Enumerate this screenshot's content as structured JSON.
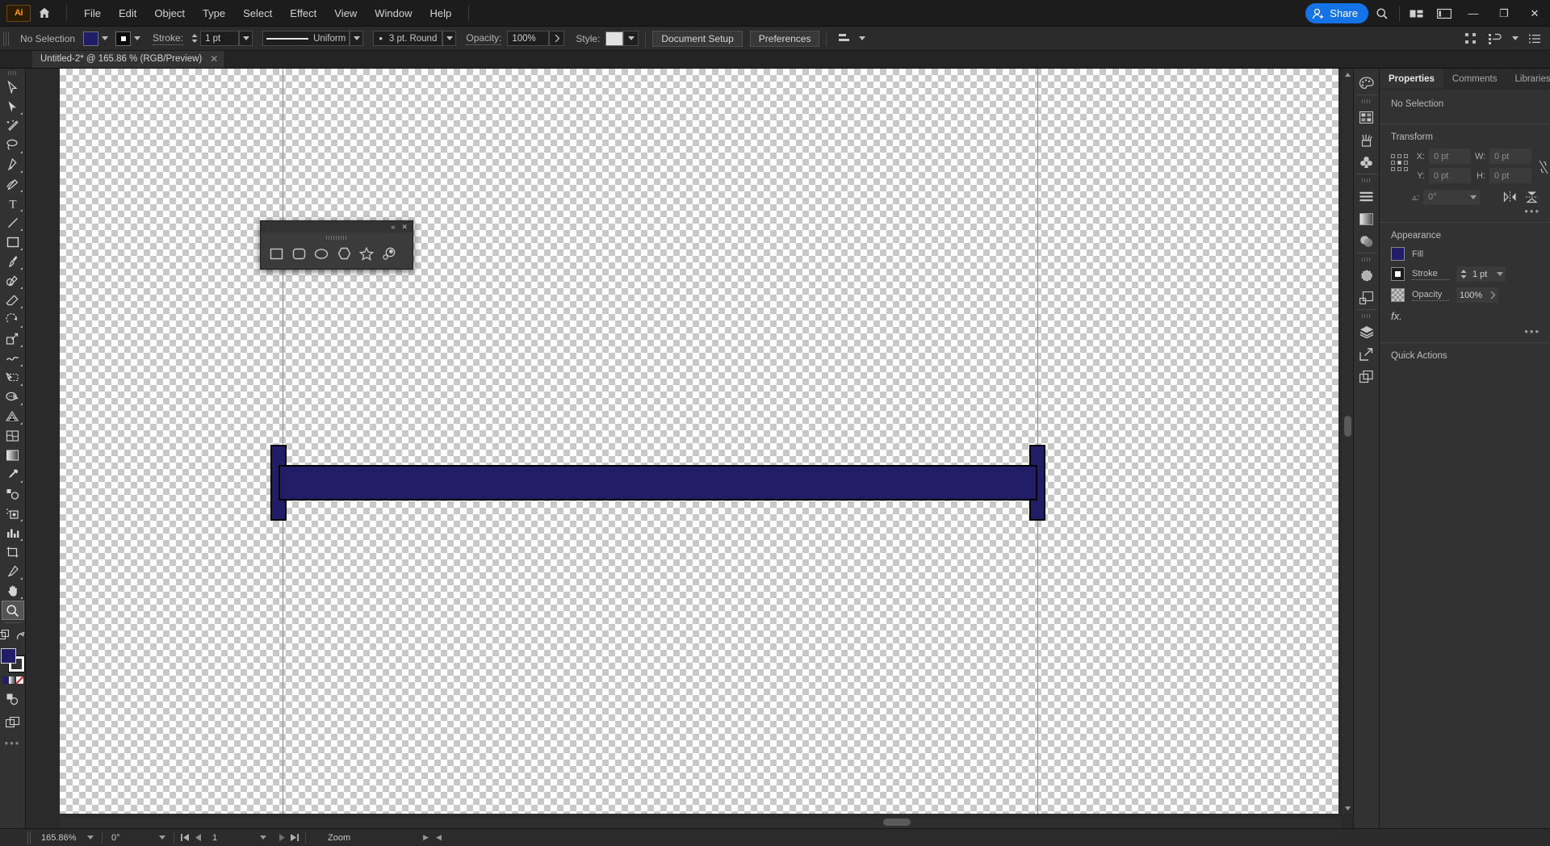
{
  "app": {
    "logo": "Ai",
    "name": "Adobe Illustrator"
  },
  "menubar": {
    "home_icon": "home-icon",
    "items": [
      "File",
      "Edit",
      "Object",
      "Type",
      "Select",
      "Effect",
      "View",
      "Window",
      "Help"
    ],
    "share_label": "Share",
    "search_icon": "search-icon",
    "arrange_icon": "arrange-documents-icon",
    "workspace_icon": "workspace-switcher-icon",
    "window_controls": {
      "minimize": "—",
      "maximize": "❐",
      "close": "✕"
    }
  },
  "controlbar": {
    "selection_status": "No Selection",
    "fill_color": "#211d66",
    "stroke_color": "#ffffff",
    "stroke_label": "Stroke:",
    "stroke_weight": "1 pt",
    "profile_label": "Uniform",
    "brush_label": "3 pt. Round",
    "opacity_label": "Opacity:",
    "opacity_value": "100%",
    "style_label": "Style:",
    "style_swatch": "#e2e2e2",
    "document_setup": "Document Setup",
    "preferences": "Preferences",
    "align_icon": "align-icon",
    "distribute_icon": "distribute-icon",
    "options_icon": "panel-options-icon"
  },
  "tab": {
    "title": "Untitled-2* @ 165.86 % (RGB/Preview)",
    "close": "✕"
  },
  "toolbar": {
    "tools": [
      {
        "name": "selection-tool",
        "icon": "arrow-outline",
        "group": false
      },
      {
        "name": "direct-selection-tool",
        "icon": "arrow-filled",
        "group": true
      },
      {
        "name": "magic-wand-tool",
        "icon": "wand",
        "group": false
      },
      {
        "name": "lasso-tool",
        "icon": "lasso",
        "group": true
      },
      {
        "name": "pen-tool",
        "icon": "pen",
        "group": true
      },
      {
        "name": "curvature-tool",
        "icon": "curvature",
        "group": false
      },
      {
        "name": "type-tool",
        "icon": "type-T",
        "group": true
      },
      {
        "name": "line-segment-tool",
        "icon": "line",
        "group": true
      },
      {
        "name": "rectangle-tool",
        "icon": "rectangle",
        "group": true
      },
      {
        "name": "paintbrush-tool",
        "icon": "paintbrush",
        "group": true
      },
      {
        "name": "shaper-tool",
        "icon": "shaper-pencil",
        "group": true
      },
      {
        "name": "eraser-tool",
        "icon": "eraser",
        "group": true
      },
      {
        "name": "rotate-tool",
        "icon": "rotate",
        "group": true
      },
      {
        "name": "scale-tool",
        "icon": "scale",
        "group": true
      },
      {
        "name": "width-tool",
        "icon": "width",
        "group": true
      },
      {
        "name": "free-transform-tool",
        "icon": "free-transform",
        "group": true
      },
      {
        "name": "shape-builder-tool",
        "icon": "shape-builder",
        "group": true
      },
      {
        "name": "perspective-grid-tool",
        "icon": "perspective-grid",
        "group": true
      },
      {
        "name": "mesh-tool",
        "icon": "mesh",
        "group": false
      },
      {
        "name": "gradient-tool",
        "icon": "gradient",
        "group": false
      },
      {
        "name": "eyedropper-tool",
        "icon": "eyedropper",
        "group": true
      },
      {
        "name": "blend-tool",
        "icon": "blend",
        "group": false
      },
      {
        "name": "symbol-sprayer-tool",
        "icon": "symbol-sprayer",
        "group": true
      },
      {
        "name": "column-graph-tool",
        "icon": "bar-graph",
        "group": true
      },
      {
        "name": "artboard-tool",
        "icon": "artboard",
        "group": false
      },
      {
        "name": "slice-tool",
        "icon": "slice",
        "group": true
      },
      {
        "name": "hand-tool",
        "icon": "hand",
        "group": true
      },
      {
        "name": "zoom-tool",
        "icon": "magnifier",
        "group": false,
        "active": true
      }
    ],
    "fill_color": "#211d66",
    "stroke_color": "#ffffff",
    "more_tools": "•••"
  },
  "shape_panel": {
    "collapse_icon": "«",
    "close_icon": "✕",
    "tools": [
      {
        "name": "rectangle-tool",
        "icon": "square"
      },
      {
        "name": "rounded-rectangle-tool",
        "icon": "rounded-square"
      },
      {
        "name": "ellipse-tool",
        "icon": "ellipse"
      },
      {
        "name": "polygon-tool",
        "icon": "hexagon"
      },
      {
        "name": "star-tool",
        "icon": "star"
      },
      {
        "name": "flare-tool",
        "icon": "flare"
      }
    ]
  },
  "artwork": {
    "shape_fill": "#211d66",
    "shape_stroke": "#000000",
    "description": "long horizontal navy bar with two vertical end caps"
  },
  "right_dock": {
    "icons": [
      "color-icon",
      "swatches-icon",
      "brushes-icon",
      "symbols-icon",
      "align-icon",
      "gradient-icon",
      "transparency-icon",
      "pathfinder-icon",
      "image-trace-icon",
      "layers-icon",
      "asset-export-icon",
      "artboards-icon"
    ]
  },
  "properties": {
    "tabs": [
      {
        "label": "Properties",
        "active": true
      },
      {
        "label": "Comments",
        "active": false
      },
      {
        "label": "Libraries",
        "active": false
      }
    ],
    "no_selection": "No Selection",
    "transform": {
      "title": "Transform",
      "x_label": "X:",
      "x_value": "0 pt",
      "y_label": "Y:",
      "y_value": "0 pt",
      "w_label": "W:",
      "w_value": "0 pt",
      "h_label": "H:",
      "h_value": "0 pt",
      "angle_label": "▵:",
      "angle_value": "0°",
      "link_icon": "broken-link-icon",
      "flip_horizontal_icon": "flip-horizontal-icon",
      "flip_vertical_icon": "flip-vertical-icon",
      "more_icon": "•••"
    },
    "appearance": {
      "title": "Appearance",
      "fill_label": "Fill",
      "fill_color": "#211d66",
      "stroke_label": "Stroke",
      "stroke_weight": "1 pt",
      "opacity_label": "Opacity",
      "opacity_value": "100%",
      "fx_label": "fx.",
      "more_icon": "•••"
    },
    "quick_actions": {
      "title": "Quick Actions"
    }
  },
  "statusbar": {
    "zoom_value": "165.86%",
    "rotation_value": "0°",
    "page_value": "1",
    "first_icon": "⏮",
    "prev_icon": "◀",
    "next_icon": "▶",
    "last_icon": "⏭",
    "status_text": "Zoom",
    "play_icon": "▶",
    "back_icon": "◀"
  }
}
